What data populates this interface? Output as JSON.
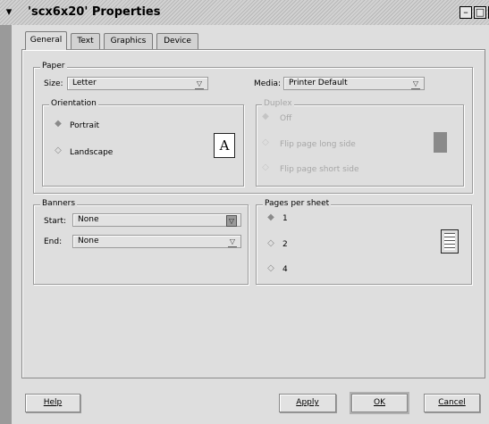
{
  "window": {
    "title": "'scx6x20' Properties",
    "menu_icon": "chevron-down-icon",
    "minimize_glyph": "–",
    "maximize_glyph": "□",
    "close_glyph": "✕"
  },
  "tabs": [
    {
      "label": "General",
      "active": true
    },
    {
      "label": "Text",
      "active": false
    },
    {
      "label": "Graphics",
      "active": false
    },
    {
      "label": "Device",
      "active": false
    }
  ],
  "paper": {
    "group_label": "Paper",
    "size_label": "Size:",
    "size_value": "Letter",
    "media_label": "Media:",
    "media_value": "Printer Default"
  },
  "orientation": {
    "group_label": "Orientation",
    "options": [
      "Portrait",
      "Landscape"
    ],
    "selected": "Portrait",
    "preview_letter": "A"
  },
  "duplex": {
    "group_label": "Duplex",
    "options": [
      "Off",
      "Flip page long side",
      "Flip page short side"
    ],
    "enabled": false
  },
  "banners": {
    "group_label": "Banners",
    "start_label": "Start:",
    "start_value": "None",
    "end_label": "End:",
    "end_value": "None"
  },
  "pages_per_sheet": {
    "group_label": "Pages per sheet",
    "options": [
      "1",
      "2",
      "4"
    ],
    "selected": "1"
  },
  "buttons": {
    "help": "Help",
    "apply": "Apply",
    "ok": "OK",
    "cancel": "Cancel"
  }
}
